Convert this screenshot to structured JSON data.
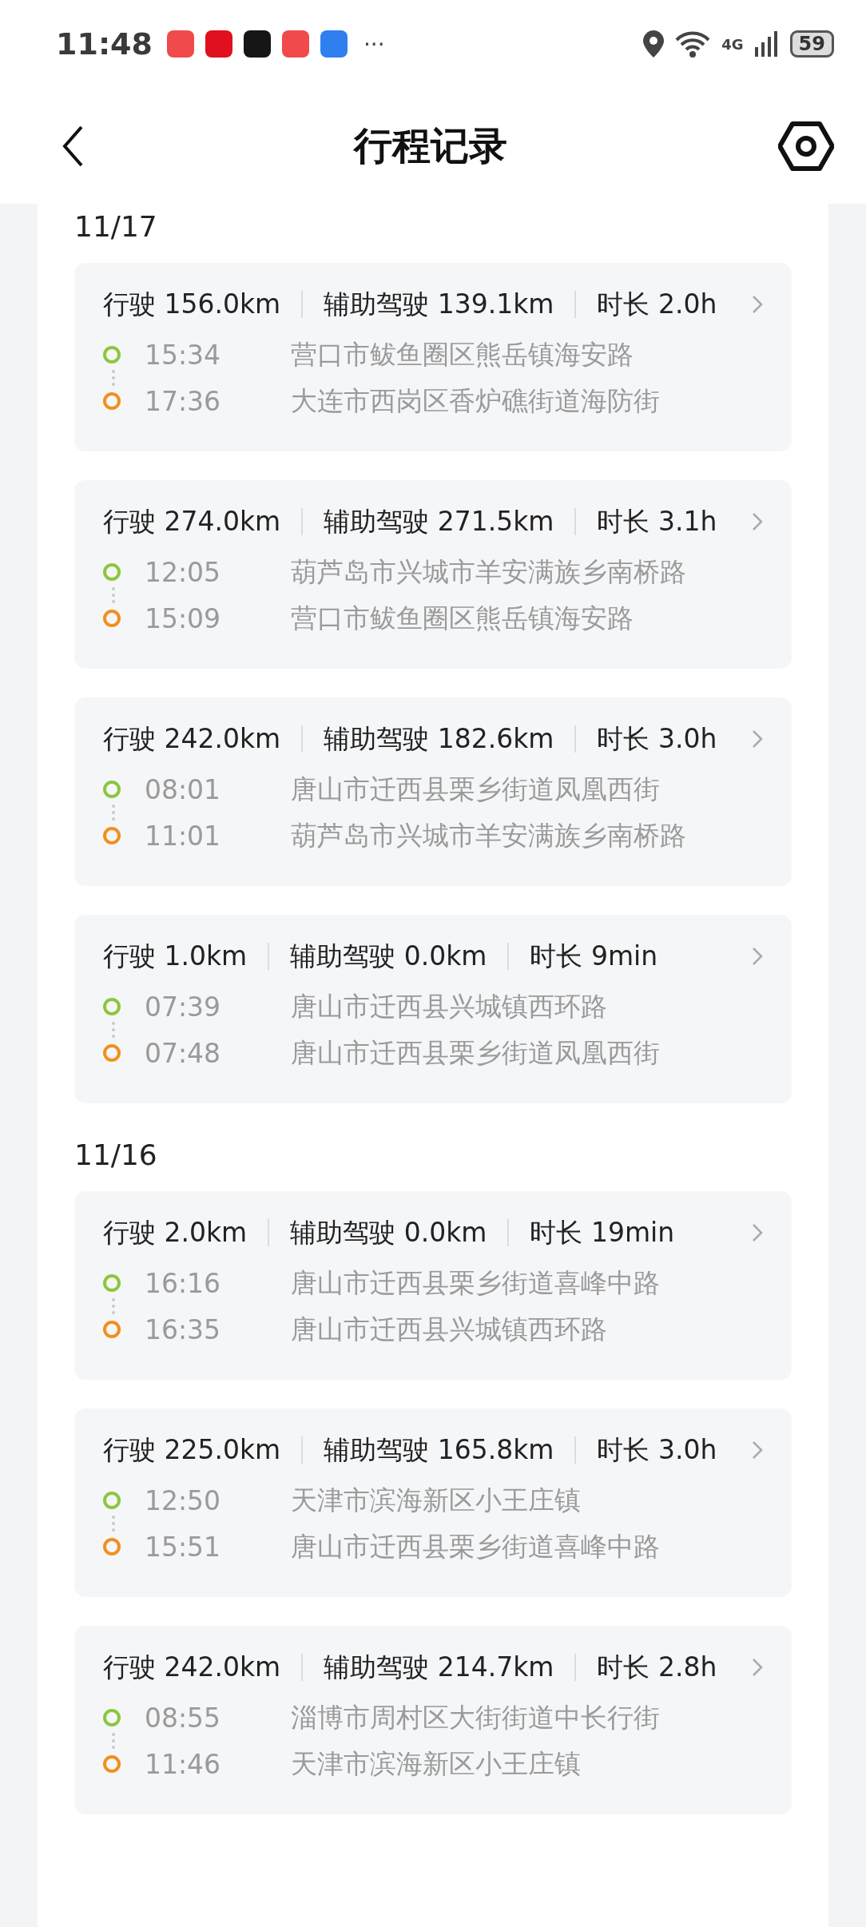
{
  "status_bar": {
    "time": "11:48",
    "apps": [
      {
        "color": "#f04a4a"
      },
      {
        "color": "#e0101e"
      },
      {
        "color": "#161616"
      },
      {
        "color": "#f04a4a"
      },
      {
        "color": "#2f7ff0"
      }
    ],
    "more": "···",
    "network": "4G",
    "battery": "59"
  },
  "header": {
    "title": "行程记录"
  },
  "sections": [
    {
      "date": "11/17",
      "trips": [
        {
          "stats": [
            "行驶 156.0km",
            "辅助驾驶 139.1km",
            "时长 2.0h"
          ],
          "start": {
            "time": "15:34",
            "place": "营口市鲅鱼圈区熊岳镇海安路"
          },
          "end": {
            "time": "17:36",
            "place": "大连市西岗区香炉礁街道海防街"
          }
        },
        {
          "stats": [
            "行驶 274.0km",
            "辅助驾驶 271.5km",
            "时长 3.1h"
          ],
          "start": {
            "time": "12:05",
            "place": "葫芦岛市兴城市羊安满族乡南桥路"
          },
          "end": {
            "time": "15:09",
            "place": "营口市鲅鱼圈区熊岳镇海安路"
          }
        },
        {
          "stats": [
            "行驶 242.0km",
            "辅助驾驶 182.6km",
            "时长 3.0h"
          ],
          "start": {
            "time": "08:01",
            "place": "唐山市迁西县栗乡街道凤凰西街"
          },
          "end": {
            "time": "11:01",
            "place": "葫芦岛市兴城市羊安满族乡南桥路"
          }
        },
        {
          "stats": [
            "行驶 1.0km",
            "辅助驾驶 0.0km",
            "时长 9min"
          ],
          "start": {
            "time": "07:39",
            "place": "唐山市迁西县兴城镇西环路"
          },
          "end": {
            "time": "07:48",
            "place": "唐山市迁西县栗乡街道凤凰西街"
          }
        }
      ]
    },
    {
      "date": "11/16",
      "trips": [
        {
          "stats": [
            "行驶 2.0km",
            "辅助驾驶 0.0km",
            "时长 19min"
          ],
          "start": {
            "time": "16:16",
            "place": "唐山市迁西县栗乡街道喜峰中路"
          },
          "end": {
            "time": "16:35",
            "place": "唐山市迁西县兴城镇西环路"
          }
        },
        {
          "stats": [
            "行驶 225.0km",
            "辅助驾驶 165.8km",
            "时长 3.0h"
          ],
          "start": {
            "time": "12:50",
            "place": "天津市滨海新区小王庄镇"
          },
          "end": {
            "time": "15:51",
            "place": "唐山市迁西县栗乡街道喜峰中路"
          }
        },
        {
          "stats": [
            "行驶 242.0km",
            "辅助驾驶 214.7km",
            "时长 2.8h"
          ],
          "start": {
            "time": "08:55",
            "place": "淄博市周村区大街街道中长行街"
          },
          "end": {
            "time": "11:46",
            "place": "天津市滨海新区小王庄镇"
          }
        }
      ]
    }
  ]
}
